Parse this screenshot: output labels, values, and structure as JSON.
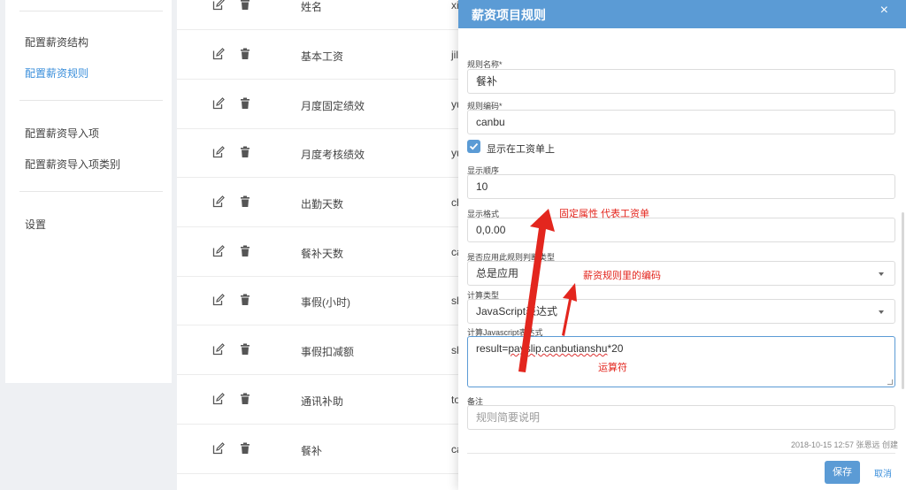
{
  "sidebar": {
    "items": [
      {
        "label": "配置薪资结构",
        "active": false
      },
      {
        "label": "配置薪资规则",
        "active": true
      },
      {
        "label": "配置薪资导入项",
        "active": false
      },
      {
        "label": "配置薪资导入项类别",
        "active": false
      },
      {
        "label": "设置",
        "active": false
      }
    ]
  },
  "table": {
    "rows": [
      {
        "name": "姓名",
        "code": "xi"
      },
      {
        "name": "基本工资",
        "code": "jil"
      },
      {
        "name": "月度固定绩效",
        "code": "yu"
      },
      {
        "name": "月度考核绩效",
        "code": "yu"
      },
      {
        "name": "出勤天数",
        "code": "ch"
      },
      {
        "name": "餐补天数",
        "code": "ca"
      },
      {
        "name": "事假(小时)",
        "code": "sh"
      },
      {
        "name": "事假扣减额",
        "code": "sh"
      },
      {
        "name": "通讯补助",
        "code": "to"
      },
      {
        "name": "餐补",
        "code": "ca"
      }
    ]
  },
  "modal": {
    "title": "薪资项目规则",
    "close": "×",
    "fields": {
      "rule_name": {
        "label": "规则名称*",
        "value": "餐补"
      },
      "rule_code": {
        "label": "规则编码*",
        "value": "canbu"
      },
      "show_on_payslip": {
        "label": "显示在工资单上",
        "checked": true,
        "checkmark": "✓"
      },
      "display_order": {
        "label": "显示顺序",
        "value": "10"
      },
      "display_format": {
        "label": "显示格式",
        "value": "0,0.00"
      },
      "apply_rule_type": {
        "label": "是否应用此规则判断类型",
        "value": "总是应用"
      },
      "calc_type": {
        "label": "计算类型",
        "value": "JavaScript表达式"
      },
      "calc_expr": {
        "label": "计算Javascript表达式",
        "value_prefix": "result=",
        "value_underlined": "payslip.canbutianshu",
        "value_suffix": "*20"
      },
      "remark": {
        "label": "备注",
        "placeholder": "规则简要说明"
      }
    },
    "meta": "2018-10-15 12:57 张恩远 创建",
    "save_label": "保存",
    "cancel_label": "取消"
  },
  "annotations": [
    {
      "text": "固定属性  代表工资单"
    },
    {
      "text": "薪资规则里的编码"
    },
    {
      "text": "运算符"
    }
  ],
  "colors": {
    "accent": "#5b9bd5",
    "link": "#3b8fdb",
    "annotation": "#e3261e"
  },
  "icons": {
    "edit": "edit-icon",
    "delete": "trash-icon",
    "close": "close-icon",
    "caret": "chevron-down-icon",
    "check": "check-icon"
  }
}
